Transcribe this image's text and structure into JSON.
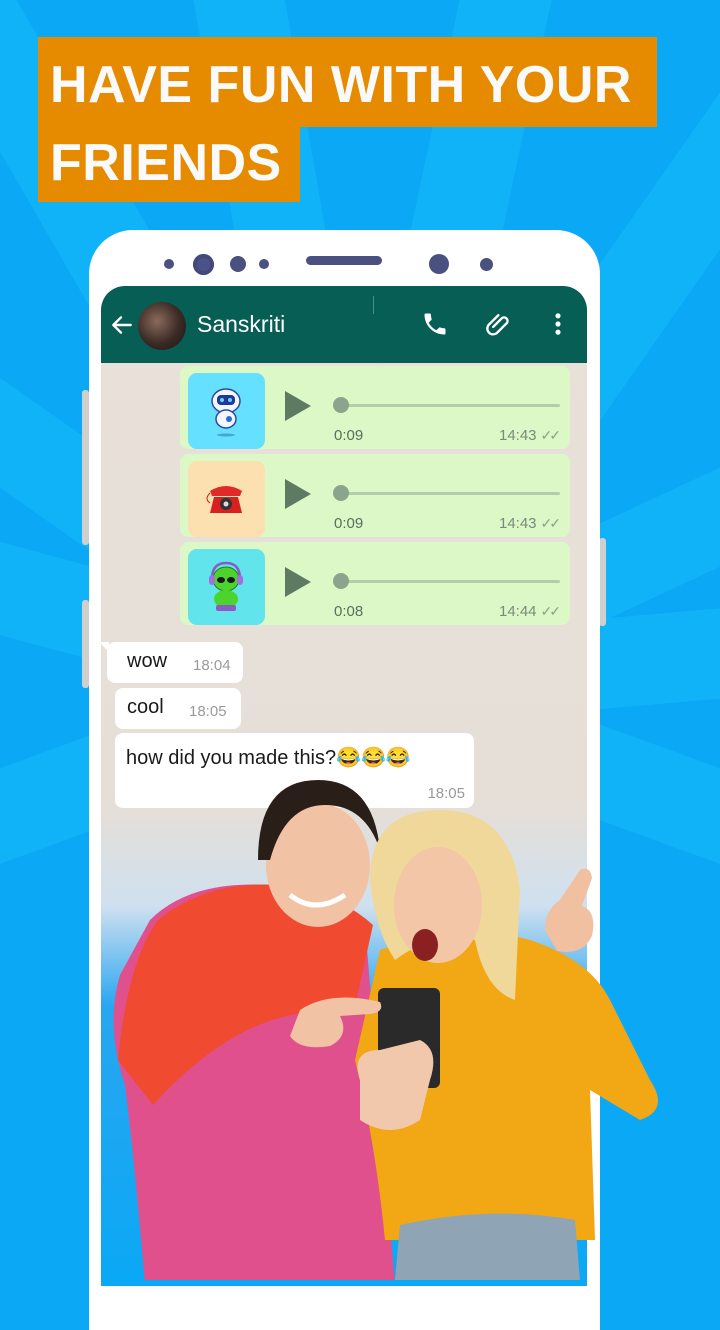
{
  "headline": {
    "line1": "HAVE FUN WITH YOUR",
    "line2": "FRIENDS",
    "bg_color": "#e68a00"
  },
  "chat": {
    "header": {
      "contact_name": "Sanskriti",
      "back_icon": "arrow-left-icon",
      "call_icon": "phone-icon",
      "attach_icon": "paperclip-icon",
      "menu_icon": "more-vertical-icon",
      "bg_color": "#075e54"
    },
    "voice_messages": [
      {
        "thumbnail": "robot-sticker",
        "thumb_bg": "#66e0ff",
        "duration": "0:09",
        "time": "14:43",
        "status": "read-double-check",
        "progress": 0
      },
      {
        "thumbnail": "red-telephone-sticker",
        "thumb_bg": "#fce0b0",
        "duration": "0:09",
        "time": "14:43",
        "status": "read-double-check",
        "progress": 0
      },
      {
        "thumbnail": "alien-gamer-sticker",
        "thumb_bg": "#62e4ec",
        "duration": "0:08",
        "time": "14:44",
        "status": "read-double-check",
        "progress": 0
      }
    ],
    "incoming_messages": [
      {
        "text": "wow",
        "time": "18:04"
      },
      {
        "text": "cool",
        "time": "18:05"
      },
      {
        "text": "how did you made this?😂😂😂",
        "time": "18:05"
      }
    ],
    "outgoing_bubble_color": "#dcf8c6"
  },
  "photo": {
    "description": "two-friends-looking-at-phone"
  },
  "ticks_glyph": "✓✓"
}
